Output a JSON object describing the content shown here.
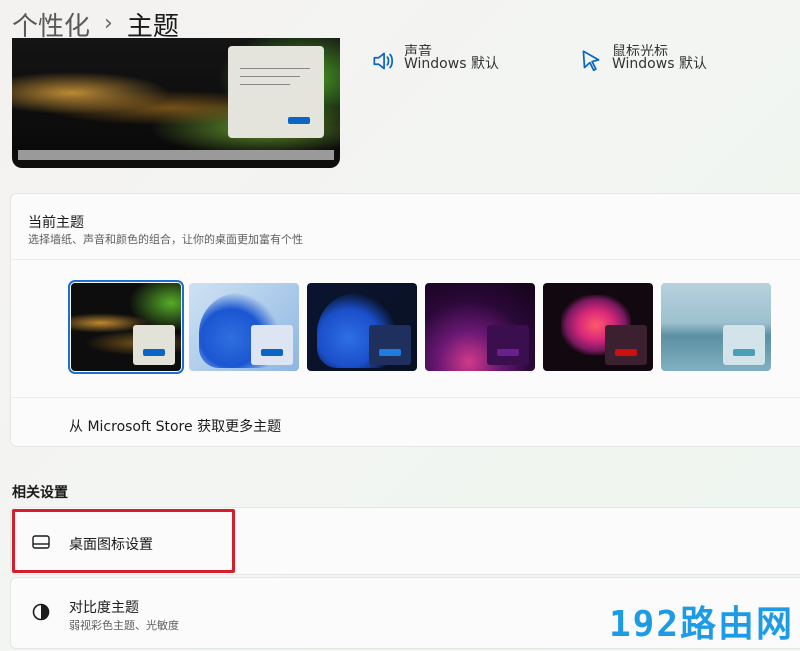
{
  "header": {
    "parent": "个性化",
    "separator": "›",
    "current": "主题"
  },
  "quick_settings": [
    {
      "label": "声音",
      "value": "Windows 默认",
      "icon": "speaker-icon"
    },
    {
      "label": "鼠标光标",
      "value": "Windows 默认",
      "icon": "cursor-icon"
    }
  ],
  "current_theme": {
    "title": "当前主题",
    "subtitle": "选择墙纸、声音和颜色的组合，让你的桌面更加富有个性",
    "store_link": "从 Microsoft Store 获取更多主题",
    "themes": [
      {
        "name": "glow",
        "selected": true,
        "bg": "#0d0d0d",
        "win": "#e3e2d8",
        "btn": "#0a66c2"
      },
      {
        "name": "windows-light",
        "selected": false,
        "bg": "#a9c9ea",
        "win": "#dde5f2",
        "btn": "#0a66c2"
      },
      {
        "name": "windows-dark",
        "selected": false,
        "bg": "#0c1a3a",
        "win": "#20305e",
        "btn": "#1e7be0"
      },
      {
        "name": "captured-motion",
        "selected": false,
        "bg": "#3b0b46",
        "win": "#3b0f4e",
        "btn": "#6a1f8e"
      },
      {
        "name": "flow",
        "selected": false,
        "bg": "#180a10",
        "win": "#3b2030",
        "btn": "#cc1010"
      },
      {
        "name": "sunrise",
        "selected": false,
        "bg": "#8fb7c8",
        "win": "#d2e3ea",
        "btn": "#4aa0b6"
      }
    ]
  },
  "related": {
    "title": "相关设置",
    "desktop_icons": {
      "label": "桌面图标设置"
    },
    "contrast": {
      "label": "对比度主题",
      "sub": "弱视彩色主题、光敏度"
    }
  },
  "watermark": "192路由网",
  "colors": {
    "accent": "#0a66c2",
    "highlight": "#d61e2a",
    "watermark": "#1e9be6"
  }
}
